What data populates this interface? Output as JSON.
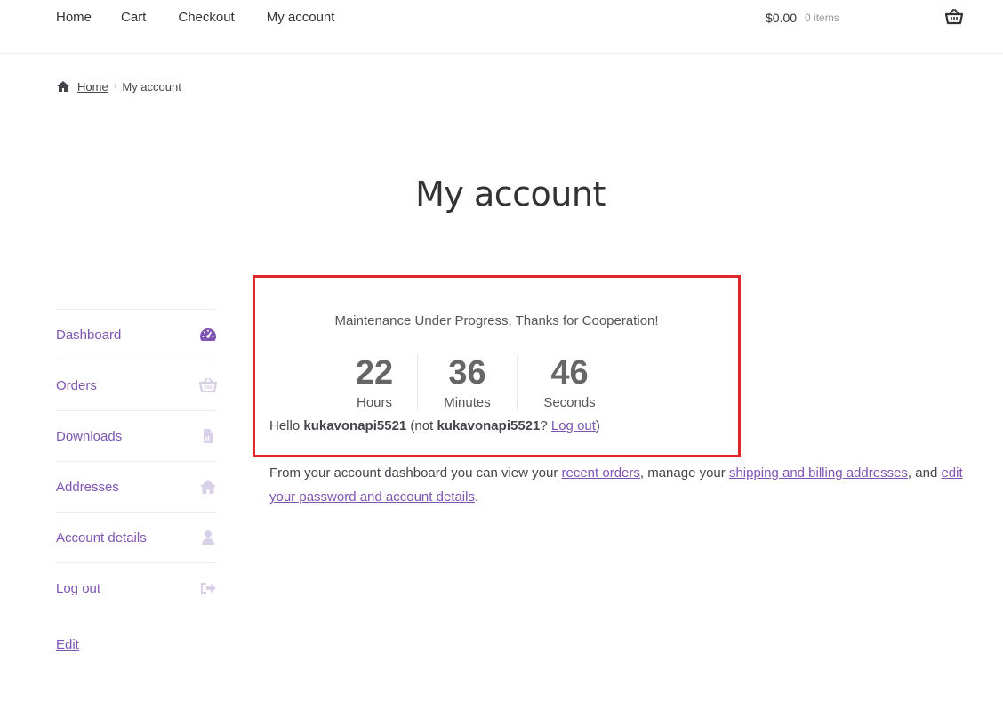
{
  "nav": {
    "items": [
      "Home",
      "Cart",
      "Checkout",
      "My account"
    ]
  },
  "cart": {
    "amount": "$0.00",
    "count": "0 items",
    "icon": "basket-icon"
  },
  "breadcrumb": {
    "home": "Home",
    "current": "My account"
  },
  "page": {
    "title": "My account"
  },
  "sidebar": {
    "items": [
      {
        "label": "Dashboard",
        "icon": "dashboard-icon"
      },
      {
        "label": "Orders",
        "icon": "basket-icon"
      },
      {
        "label": "Downloads",
        "icon": "file-icon"
      },
      {
        "label": "Addresses",
        "icon": "home-icon"
      },
      {
        "label": "Account details",
        "icon": "user-icon"
      },
      {
        "label": "Log out",
        "icon": "sign-out-icon"
      }
    ],
    "edit": "Edit"
  },
  "notice": {
    "message": "Maintenance Under Progress, Thanks for Cooperation!",
    "countdown": [
      {
        "value": "22",
        "label": "Hours"
      },
      {
        "value": "36",
        "label": "Minutes"
      },
      {
        "value": "46",
        "label": "Seconds"
      }
    ]
  },
  "hello": {
    "prefix": "Hello ",
    "username": "kukavonapi5521",
    "mid": " (not ",
    "username2": "kukavonapi5521",
    "q": "? ",
    "logout": "Log out",
    "close": ")"
  },
  "dashboard": {
    "t1": "From your account dashboard you can view your ",
    "link1": "recent orders",
    "t2": ", manage your ",
    "link2": "shipping and billing addresses",
    "t3": ", and ",
    "link3": "edit your password and account details",
    "t4": "."
  },
  "colors": {
    "accent": "#7f54b3",
    "notice_border": "#e1262d",
    "dashboard_icon": "#7f54b3",
    "muted_icon": "#d8d0e6"
  }
}
